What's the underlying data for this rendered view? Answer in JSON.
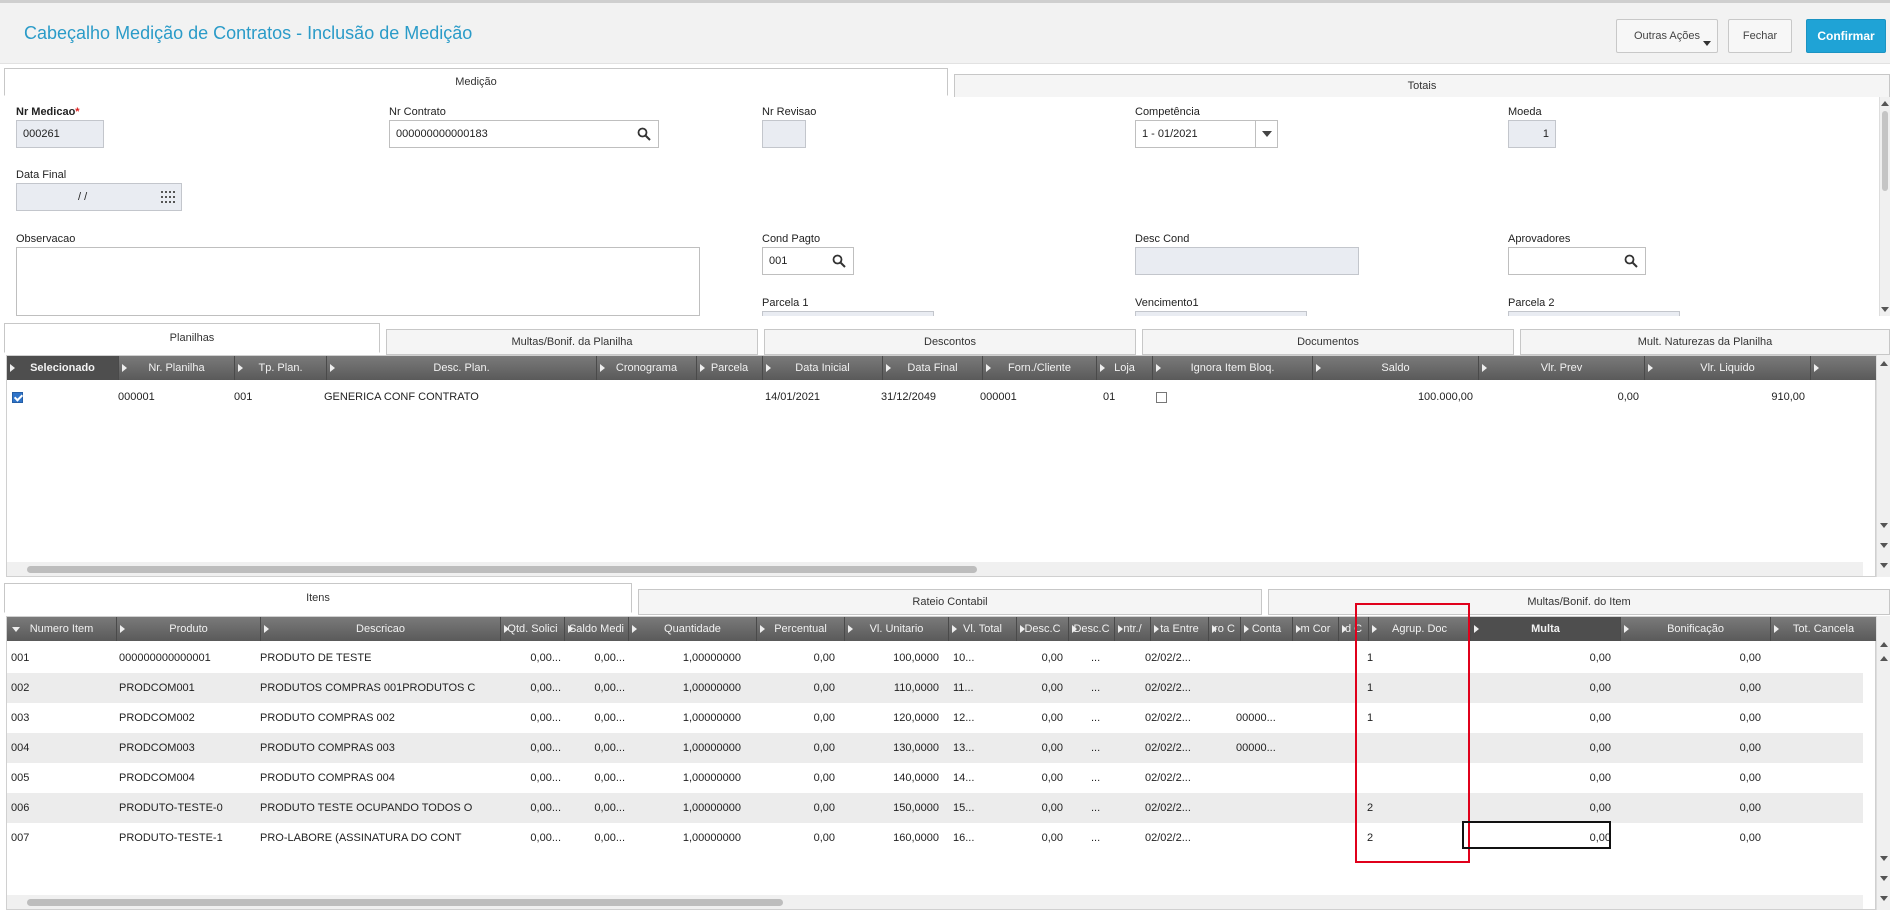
{
  "header": {
    "title": "Cabeçalho Medição de Contratos - Inclusão de Medição",
    "outras_acoes": "Outras Ações",
    "fechar": "Fechar",
    "confirmar": "Confirmar"
  },
  "top_tabs": [
    "Medição",
    "Totais"
  ],
  "form": {
    "nr_medicao_label": "Nr Medicao",
    "nr_medicao_required": "*",
    "nr_medicao_value": "000261",
    "nr_contrato_label": "Nr Contrato",
    "nr_contrato_value": "000000000000183",
    "nr_revisao_label": "Nr Revisao",
    "nr_revisao_value": "",
    "competencia_label": "Competência",
    "competencia_value": "1 - 01/2021",
    "moeda_label": "Moeda",
    "moeda_value": "1",
    "data_final_label": "Data Final",
    "data_final_value": "/ /",
    "observacao_label": "Observacao",
    "observacao_value": "",
    "cond_pagto_label": "Cond Pagto",
    "cond_pagto_value": "001",
    "desc_cond_label": "Desc Cond",
    "desc_cond_value": "",
    "aprovadores_label": "Aprovadores",
    "aprovadores_value": "",
    "parcela1_label": "Parcela 1",
    "vencimento1_label": "Vencimento1",
    "parcela2_label": "Parcela 2"
  },
  "mid_tabs": [
    "Planilhas",
    "Multas/Bonif. da Planilha",
    "Descontos",
    "Documentos",
    "Mult. Naturezas da Planilha"
  ],
  "planilhas": {
    "headers": [
      "Selecionado",
      "Nr. Planilha",
      "Tp. Plan.",
      "Desc. Plan.",
      "Cronograma",
      "Parcela",
      "Data Inicial",
      "Data Final",
      "Forn./Cliente",
      "Loja",
      "Ignora Item Bloq.",
      "Saldo",
      "Vlr. Prev",
      "Vlr. Liquido"
    ],
    "rows": [
      {
        "selecionado": true,
        "nr_planilha": "000001",
        "tp_plan": "001",
        "desc_plan": "GENERICA CONF CONTRATO",
        "cronograma": "",
        "parcela": "",
        "data_inicial": "14/01/2021",
        "data_final": "31/12/2049",
        "forn_cliente": "000001",
        "loja": "01",
        "ignora": false,
        "saldo": "100.000,00",
        "vlr_prev": "0,00",
        "vlr_liquido": "910,00"
      }
    ]
  },
  "bottom_tabs": [
    "Itens",
    "Rateio Contabil",
    "Multas/Bonif. do Item"
  ],
  "itens": {
    "headers": [
      "Numero Item",
      "Produto",
      "Descricao",
      "Qtd. Solici",
      "Saldo Medi",
      "Quantidade",
      "Percentual",
      "Vl. Unitario",
      "Vl. Total",
      "Desc.C",
      "Desc.C",
      "ntr./",
      "ta Entre",
      "ro C",
      "Conta",
      "m Cor",
      "d C",
      "Agrup. Doc",
      "Multa",
      "Bonificação",
      "Tot. Cancela"
    ],
    "rows": [
      {
        "item": "001",
        "produto": "000000000000001",
        "descricao": "PRODUTO DE TESTE",
        "qtd_sol": "0,00...",
        "saldo": "0,00...",
        "quantidade": "1,00000000",
        "percentual": "0,00",
        "vl_unit": "100,0000",
        "vl_total": "10...",
        "desc1": "0,00",
        "desc2": "...",
        "entrega": "02/02/2...",
        "conta": "",
        "agrup": "1",
        "multa": "0,00",
        "bonif": "0,00"
      },
      {
        "item": "002",
        "produto": "PRODCOM001",
        "descricao": "PRODUTOS COMPRAS 001PRODUTOS C",
        "qtd_sol": "0,00...",
        "saldo": "0,00...",
        "quantidade": "1,00000000",
        "percentual": "0,00",
        "vl_unit": "110,0000",
        "vl_total": "11...",
        "desc1": "0,00",
        "desc2": "...",
        "entrega": "02/02/2...",
        "conta": "",
        "agrup": "1",
        "multa": "0,00",
        "bonif": "0,00"
      },
      {
        "item": "003",
        "produto": "PRODCOM002",
        "descricao": "PRODUTO COMPRAS 002",
        "qtd_sol": "0,00...",
        "saldo": "0,00...",
        "quantidade": "1,00000000",
        "percentual": "0,00",
        "vl_unit": "120,0000",
        "vl_total": "12...",
        "desc1": "0,00",
        "desc2": "...",
        "entrega": "02/02/2...",
        "conta": "00000...",
        "agrup": "1",
        "multa": "0,00",
        "bonif": "0,00"
      },
      {
        "item": "004",
        "produto": "PRODCOM003",
        "descricao": "PRODUTO COMPRAS 003",
        "qtd_sol": "0,00...",
        "saldo": "0,00...",
        "quantidade": "1,00000000",
        "percentual": "0,00",
        "vl_unit": "130,0000",
        "vl_total": "13...",
        "desc1": "0,00",
        "desc2": "...",
        "entrega": "02/02/2...",
        "conta": "00000...",
        "agrup": "",
        "multa": "0,00",
        "bonif": "0,00"
      },
      {
        "item": "005",
        "produto": "PRODCOM004",
        "descricao": "PRODUTO COMPRAS 004",
        "qtd_sol": "0,00...",
        "saldo": "0,00...",
        "quantidade": "1,00000000",
        "percentual": "0,00",
        "vl_unit": "140,0000",
        "vl_total": "14...",
        "desc1": "0,00",
        "desc2": "...",
        "entrega": "02/02/2...",
        "conta": "",
        "agrup": "",
        "multa": "0,00",
        "bonif": "0,00"
      },
      {
        "item": "006",
        "produto": "PRODUTO-TESTE-0",
        "descricao": "PRODUTO TESTE OCUPANDO TODOS O",
        "qtd_sol": "0,00...",
        "saldo": "0,00...",
        "quantidade": "1,00000000",
        "percentual": "0,00",
        "vl_unit": "150,0000",
        "vl_total": "15...",
        "desc1": "0,00",
        "desc2": "...",
        "entrega": "02/02/2...",
        "conta": "",
        "agrup": "2",
        "multa": "0,00",
        "bonif": "0,00"
      },
      {
        "item": "007",
        "produto": "PRODUTO-TESTE-1",
        "descricao": "PRO-LABORE (ASSINATURA DO CONT",
        "qtd_sol": "0,00...",
        "saldo": "0,00...",
        "quantidade": "1,00000000",
        "percentual": "0,00",
        "vl_unit": "160,0000",
        "vl_total": "16...",
        "desc1": "0,00",
        "desc2": "...",
        "entrega": "02/02/2...",
        "conta": "",
        "agrup": "2",
        "multa": "0,00",
        "bonif": "0,00"
      }
    ]
  },
  "colors": {
    "title": "#2a9bc8",
    "primary": "#1fa3d6",
    "highlight": "#e0001b"
  }
}
